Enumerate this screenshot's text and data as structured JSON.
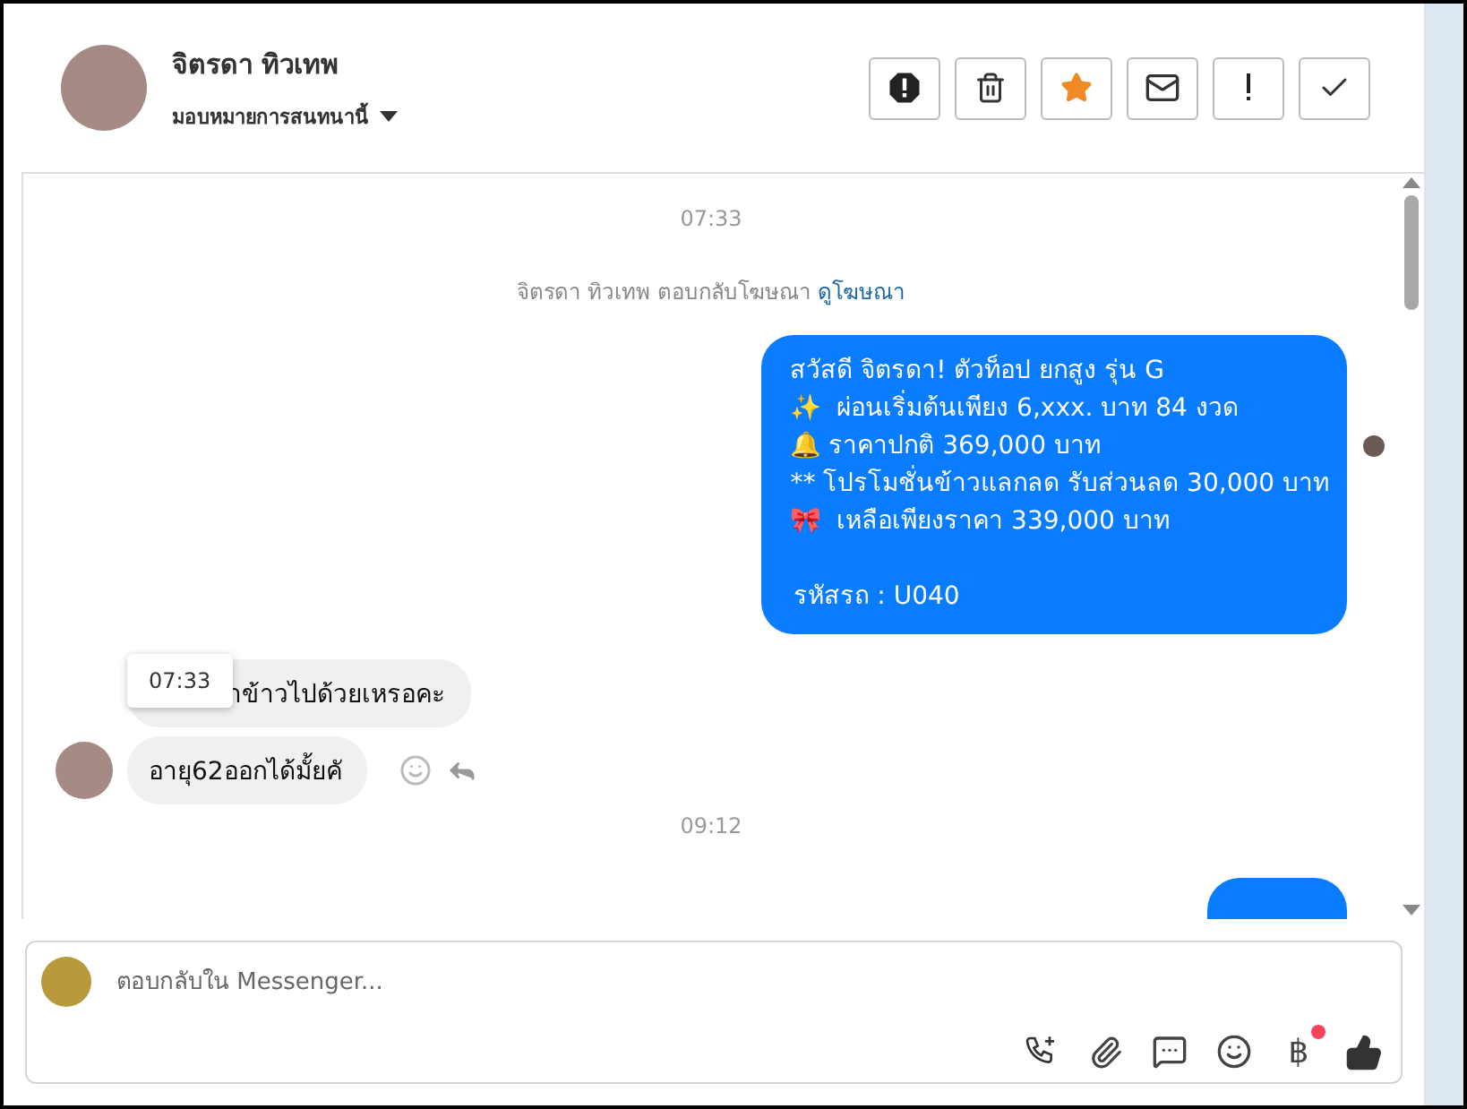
{
  "header": {
    "name": "จิตรดา ทิวเทพ",
    "assign_label": "มอบหมายการสนทนานี้",
    "actions": [
      {
        "kind": "alert"
      },
      {
        "kind": "trash"
      },
      {
        "kind": "star"
      },
      {
        "kind": "mail"
      },
      {
        "kind": "exclaim"
      },
      {
        "kind": "check"
      }
    ]
  },
  "messages": [
    {
      "kind": "time",
      "text": "07:33"
    },
    {
      "kind": "notice",
      "text": "จิตรดา ทิวเทพ ตอบกลับโฆษณา",
      "link": "ดูโฆษณา"
    },
    {
      "kind": "outgoing",
      "lines": [
        "สวัสดี จิตรดา! ตัวท็อป ยกสูง รุ่น G",
        "✨  ผ่อนเริ่มต้นเพียง 6,xxx. บาท 84 งวด",
        "🔔 ราคาปกติ 369,000 บาท",
        "** โปรโมชั่นข้าวแลกลด รับส่วนลด 30,000 บาท",
        "🎀  เหลือเพียงราคา 339,000 บาท"
      ],
      "code": "รหัสรถ : U040",
      "seen": true
    },
    {
      "kind": "incoming",
      "text": "าข้าวไปด้วยเหรอคะ",
      "tooltip": "07:33",
      "avatar": false,
      "actions": false
    },
    {
      "kind": "incoming",
      "text": "อายุ62ออกได้มั้ยคั",
      "avatar": true,
      "actions": true
    },
    {
      "kind": "time",
      "text": "09:12"
    },
    {
      "kind": "outgoing_cut"
    }
  ],
  "composer": {
    "placeholder": "ตอบกลับใน Messenger...",
    "tools": [
      {
        "kind": "call"
      },
      {
        "kind": "attach"
      },
      {
        "kind": "chat"
      },
      {
        "kind": "emoji"
      },
      {
        "kind": "currency",
        "text": "฿",
        "notification": true
      },
      {
        "kind": "like"
      }
    ]
  }
}
